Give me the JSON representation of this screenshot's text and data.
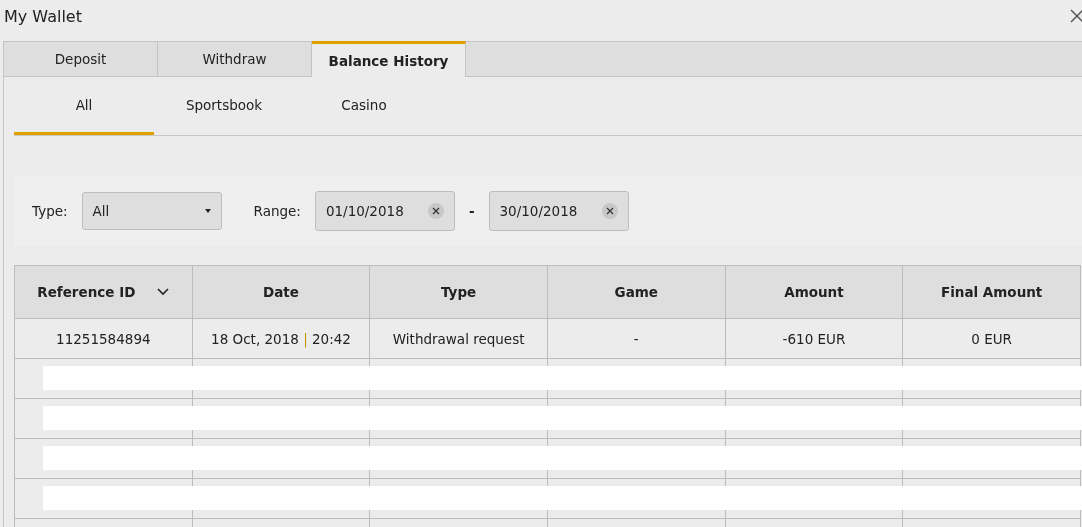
{
  "window": {
    "title": "My Wallet"
  },
  "tabs": [
    {
      "label": "Deposit",
      "selected": false
    },
    {
      "label": "Withdraw",
      "selected": false
    },
    {
      "label": "Balance History",
      "selected": true
    }
  ],
  "subtabs": [
    {
      "label": "All",
      "selected": true
    },
    {
      "label": "Sportsbook",
      "selected": false
    },
    {
      "label": "Casino",
      "selected": false
    }
  ],
  "filters": {
    "type_label": "Type:",
    "type_value": "All",
    "range_label": "Range:",
    "range_from": "01/10/2018",
    "range_separator": "-",
    "range_to": "30/10/2018"
  },
  "table": {
    "columns": [
      {
        "label": "Reference ID",
        "sorted": true
      },
      {
        "label": "Date",
        "sorted": false
      },
      {
        "label": "Type",
        "sorted": false
      },
      {
        "label": "Game",
        "sorted": false
      },
      {
        "label": "Amount",
        "sorted": false
      },
      {
        "label": "Final Amount",
        "sorted": false
      }
    ],
    "rows": [
      {
        "kind": "data",
        "reference_id": "11251584894",
        "date": "18 Oct, 2018",
        "separator": "|",
        "time": "20:42",
        "type": "Withdrawal request",
        "game": "-",
        "amount": "-610 EUR",
        "final_amount": "0 EUR"
      },
      {
        "kind": "redacted"
      },
      {
        "kind": "redacted"
      },
      {
        "kind": "redacted"
      },
      {
        "kind": "redacted"
      },
      {
        "kind": "empty"
      }
    ]
  }
}
